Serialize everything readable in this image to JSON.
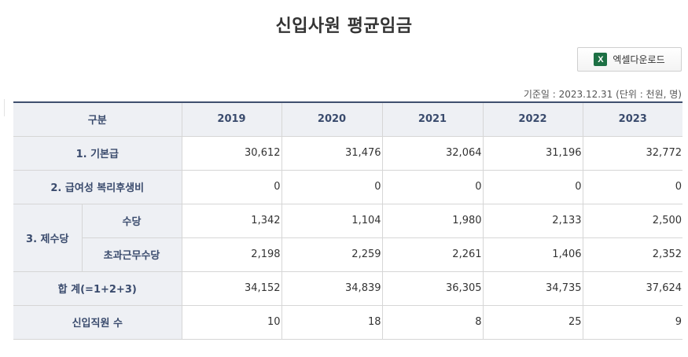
{
  "title": "신입사원 평균임금",
  "excel_button": {
    "label": "엑셀다운로드",
    "icon": "excel-icon",
    "icon_glyph": "X",
    "icon_color": "#1d7044"
  },
  "standard_info": "기준일 : 2023.12.31 (단위 : 천원, 명)",
  "table": {
    "header": {
      "category": "구분",
      "years": [
        "2019",
        "2020",
        "2021",
        "2022",
        "2023"
      ]
    },
    "rows": {
      "basic_pay": {
        "label": "1. 기본급",
        "values": [
          "30,612",
          "31,476",
          "32,064",
          "31,196",
          "32,772"
        ]
      },
      "welfare": {
        "label": "2. 급여성 복리후생비",
        "values": [
          "0",
          "0",
          "0",
          "0",
          "0"
        ]
      },
      "allowance_group": {
        "label": "3. 제수당"
      },
      "allowance": {
        "label": "수당",
        "values": [
          "1,342",
          "1,104",
          "1,980",
          "2,133",
          "2,500"
        ]
      },
      "overtime": {
        "label": "초과근무수당",
        "values": [
          "2,198",
          "2,259",
          "2,261",
          "1,406",
          "2,352"
        ]
      },
      "total": {
        "label": "합 계(=1+2+3)",
        "values": [
          "34,152",
          "34,839",
          "36,305",
          "34,735",
          "37,624"
        ]
      },
      "new_hires": {
        "label": "신입직원 수",
        "values": [
          "10",
          "18",
          "8",
          "25",
          "9"
        ]
      }
    }
  },
  "colors": {
    "header_bg": "#eef0f4",
    "header_text": "#3a4b6d",
    "top_border": "#3f4f6e"
  }
}
